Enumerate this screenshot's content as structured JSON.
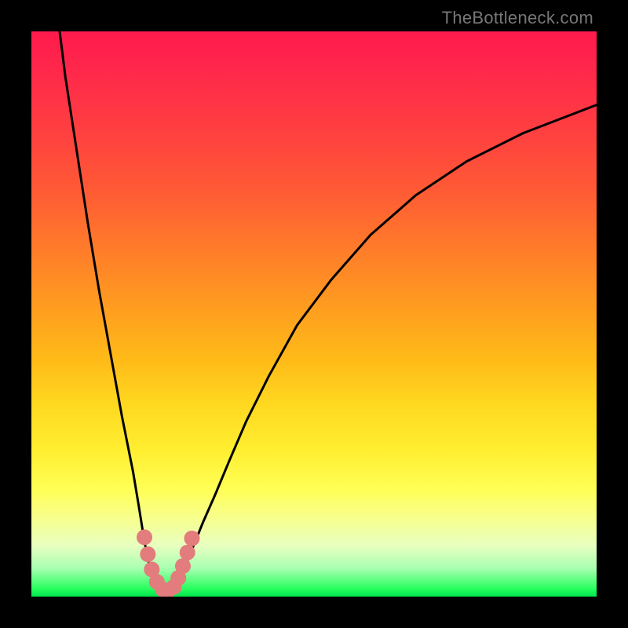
{
  "watermark": "TheBottleneck.com",
  "chart_data": {
    "type": "line",
    "title": "",
    "xlabel": "",
    "ylabel": "",
    "xlim": [
      0,
      100
    ],
    "ylim": [
      0,
      100
    ],
    "grid": false,
    "series": [
      {
        "name": "left-arm",
        "x": [
          5,
          6,
          8,
          10,
          12,
          14,
          16,
          18,
          19,
          19.8,
          20.5,
          21.2,
          22,
          22.8,
          23.5
        ],
        "values": [
          100,
          92,
          79,
          66,
          54,
          43,
          32,
          22,
          16,
          11,
          7,
          4.5,
          2.8,
          1.6,
          0.9
        ]
      },
      {
        "name": "right-arm",
        "x": [
          24.5,
          25.3,
          26.2,
          27.3,
          28.6,
          30.3,
          32.5,
          35,
          38,
          42,
          47,
          53,
          60,
          68,
          77,
          87,
          100
        ],
        "values": [
          0.9,
          1.7,
          3.2,
          5.6,
          8.8,
          13,
          18,
          24,
          31,
          39,
          48,
          56,
          64,
          71,
          77,
          82,
          87
        ]
      },
      {
        "name": "valley-floor",
        "x": [
          23.5,
          23.7,
          24.0,
          24.2,
          24.5
        ],
        "values": [
          0.9,
          0.55,
          0.45,
          0.55,
          0.9
        ]
      }
    ],
    "markers": [
      {
        "name": "left-cluster",
        "x": 20.0,
        "y": 10.5
      },
      {
        "name": "left-cluster",
        "x": 20.6,
        "y": 7.5
      },
      {
        "name": "left-cluster",
        "x": 21.3,
        "y": 4.8
      },
      {
        "name": "left-cluster",
        "x": 22.2,
        "y": 2.6
      },
      {
        "name": "left-cluster",
        "x": 23.2,
        "y": 1.3
      },
      {
        "name": "left-cluster",
        "x": 24.0,
        "y": 0.8
      },
      {
        "name": "right-cluster",
        "x": 25.2,
        "y": 1.7
      },
      {
        "name": "right-cluster",
        "x": 26.0,
        "y": 3.3
      },
      {
        "name": "right-cluster",
        "x": 26.8,
        "y": 5.4
      },
      {
        "name": "right-cluster",
        "x": 27.6,
        "y": 7.8
      },
      {
        "name": "right-cluster",
        "x": 28.4,
        "y": 10.3
      }
    ],
    "legend": false
  },
  "colors": {
    "curve": "#000000",
    "marker": "#e37c7c",
    "frame": "#000000"
  }
}
